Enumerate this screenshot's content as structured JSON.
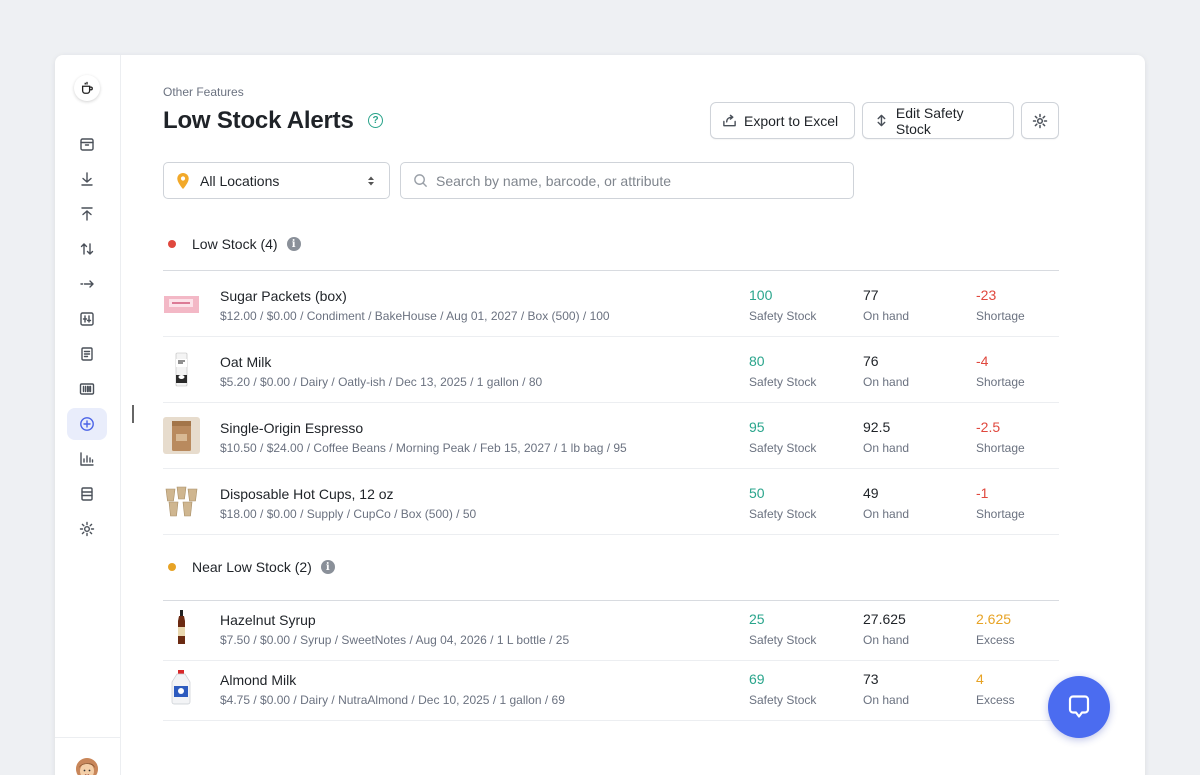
{
  "breadcrumb": "Other Features",
  "page_title": "Low Stock Alerts",
  "help_glyph": "?",
  "info_glyph": "i",
  "toolbar": {
    "export_label": "Export to Excel",
    "edit_label": "Edit Safety Stock"
  },
  "filters": {
    "location_value": "All Locations",
    "search_placeholder": "Search by name, barcode, or attribute"
  },
  "sections": {
    "low": {
      "heading": "Low Stock (4)",
      "dot_color": "#e0483e",
      "items": [
        {
          "name": "Sugar Packets (box)",
          "meta": "$12.00 / $0.00 / Condiment / BakeHouse / Aug 01, 2027 / Box (500) / 100",
          "safety": "100",
          "safety_label": "Safety Stock",
          "onhand": "77",
          "onhand_label": "On hand",
          "diff": "-23",
          "diff_label": "Shortage",
          "thumb": "sugar-packets"
        },
        {
          "name": "Oat Milk",
          "meta": "$5.20 / $0.00 / Dairy / Oatly-ish / Dec 13, 2025 / 1 gallon / 80",
          "safety": "80",
          "safety_label": "Safety Stock",
          "onhand": "76",
          "onhand_label": "On hand",
          "diff": "-4",
          "diff_label": "Shortage",
          "thumb": "oat-milk"
        },
        {
          "name": "Single-Origin Espresso",
          "meta": "$10.50 / $24.00 / Coffee Beans / Morning Peak / Feb 15, 2027 / 1 lb bag / 95",
          "safety": "95",
          "safety_label": "Safety Stock",
          "onhand": "92.5",
          "onhand_label": "On hand",
          "diff": "-2.5",
          "diff_label": "Shortage",
          "thumb": "coffee-bag"
        },
        {
          "name": "Disposable Hot Cups, 12 oz",
          "meta": "$18.00 / $0.00 / Supply / CupCo / Box (500) / 50",
          "safety": "50",
          "safety_label": "Safety Stock",
          "onhand": "49",
          "onhand_label": "On hand",
          "diff": "-1",
          "diff_label": "Shortage",
          "thumb": "paper-cups"
        }
      ]
    },
    "near": {
      "heading": "Near Low Stock (2)",
      "dot_color": "#e7a325",
      "items": [
        {
          "name": "Hazelnut Syrup",
          "meta": "$7.50 / $0.00 / Syrup / SweetNotes / Aug 04, 2026 / 1 L bottle / 25",
          "safety": "25",
          "safety_label": "Safety Stock",
          "onhand": "27.625",
          "onhand_label": "On hand",
          "diff": "2.625",
          "diff_label": "Excess",
          "thumb": "syrup-bottle"
        },
        {
          "name": "Almond Milk",
          "meta": "$4.75 / $0.00 / Dairy / NutraAlmond / Dec 10, 2025 / 1 gallon / 69",
          "safety": "69",
          "safety_label": "Safety Stock",
          "onhand": "73",
          "onhand_label": "On hand",
          "diff": "4",
          "diff_label": "Excess",
          "thumb": "milk-jug"
        }
      ]
    }
  },
  "colors": {
    "accent": "#4b6cf0",
    "safety": "#2aa58c",
    "shortage": "#e0483e",
    "excess": "#e7a325"
  },
  "nav_icons": [
    "box-icon",
    "download-icon",
    "upload-icon",
    "transfer-icon",
    "move-icon",
    "adjust-icon",
    "document-icon",
    "barcode-icon",
    "alert-plus-icon",
    "chart-icon",
    "report-icon",
    "settings-icon"
  ]
}
